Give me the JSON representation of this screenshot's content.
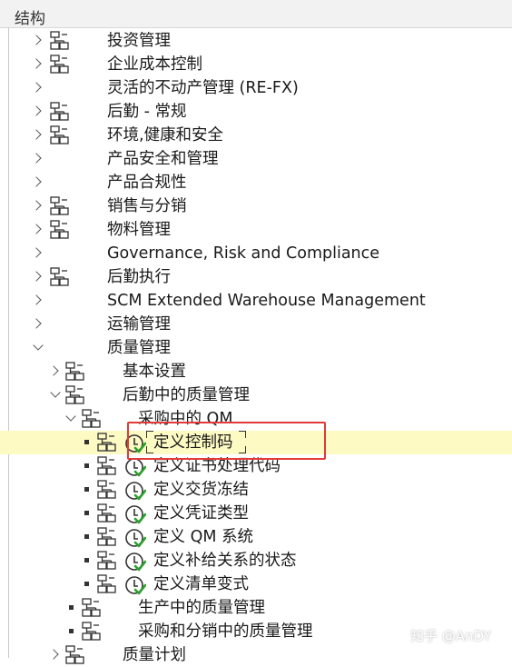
{
  "header": {
    "title": "结构"
  },
  "tree": {
    "invest": "投资管理",
    "enterprise_cost": "企业成本控制",
    "re_fx": "灵活的不动产管理 (RE-FX)",
    "logistics_general": "后勤 - 常规",
    "ehs": "环境,健康和安全",
    "product_safety": "产品安全和管理",
    "product_compliance": "产品合规性",
    "sales": "销售与分销",
    "materials": "物料管理",
    "grc": "Governance, Risk and Compliance",
    "logistics_exec": "后勤执行",
    "ewm": "SCM Extended Warehouse Management",
    "transport": "运输管理",
    "qm": "质量管理",
    "qm_basic": "基本设置",
    "qm_logistics": "后勤中的质量管理",
    "qm_procurement": "采购中的 QM",
    "define_control_key": "定义控制码",
    "define_cert_processing": "定义证书处理代码",
    "define_delivery_block": "定义交货冻结",
    "define_voucher_types": "定义凭证类型",
    "define_qm_systems": "定义 QM 系统",
    "define_supply_status": "定义补给关系的状态",
    "define_list_variants": "定义清单变式",
    "qm_production": "生产中的质量管理",
    "qm_purch_sales": "采购和分销中的质量管理",
    "quality_planning": "质量计划"
  },
  "watermark": "知乎 @AnDY",
  "colors": {
    "selection": "#fdfac4",
    "highlight_box": "#e03a3a",
    "check": "#2ca02c"
  }
}
